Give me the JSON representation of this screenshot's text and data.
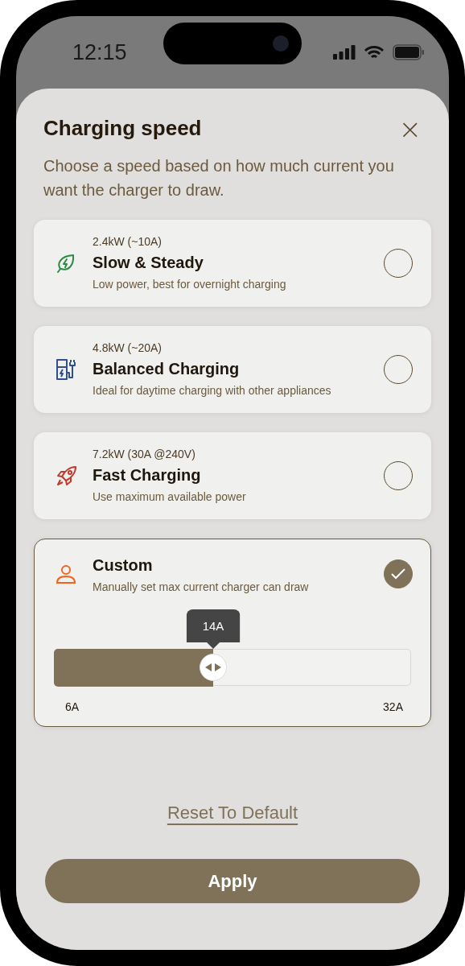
{
  "status_bar": {
    "time": "12:15"
  },
  "sheet": {
    "title": "Charging speed",
    "close_icon": "×",
    "subtitle": "Choose a speed based on how much current you want the charger to draw."
  },
  "options": [
    {
      "kind": "preset",
      "power": "2.4kW (~10A)",
      "title": "Slow & Steady",
      "description": "Low power, best for overnight charging",
      "selected": false
    },
    {
      "kind": "preset",
      "power": "4.8kW (~20A)",
      "title": "Balanced Charging",
      "description": "Ideal for daytime charging with other appliances",
      "selected": false
    },
    {
      "kind": "preset",
      "power": "7.2kW (30A @240V)",
      "title": "Fast Charging",
      "description": "Use maximum available power",
      "selected": false
    },
    {
      "kind": "custom",
      "title": "Custom",
      "description": "Manually set max current charger can draw",
      "selected": true,
      "slider": {
        "value": "14A",
        "level": 0.446,
        "min": "6A",
        "max": "32A"
      }
    }
  ],
  "reset_link": "Reset To Default",
  "apply_button": "Apply"
}
